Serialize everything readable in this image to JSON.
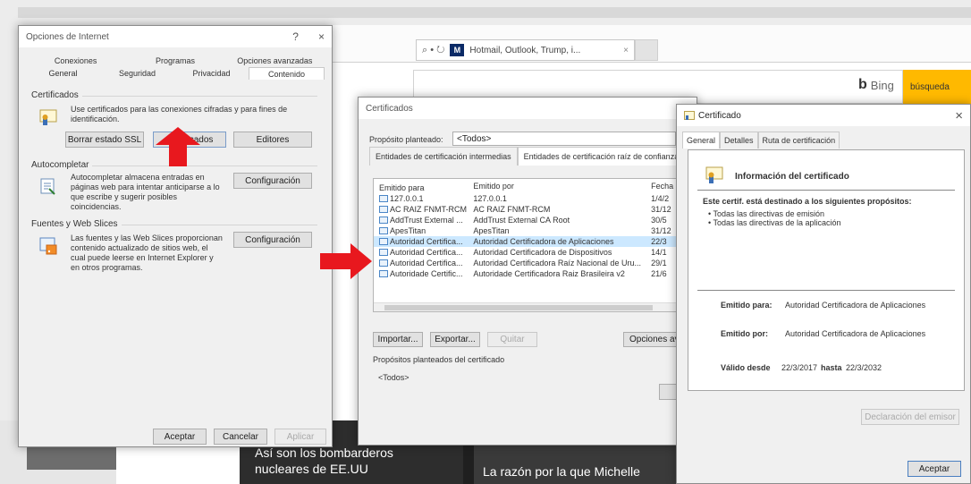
{
  "browser": {
    "tab_title": "Hotmail, Outlook, Trump, i...",
    "address_controls": "⌕ • ↻",
    "search_brand": "Bing",
    "search_button": "búsqueda",
    "news": [
      "Así son los bombarderos nucleares de EE.UU",
      "La razón por la que Michelle"
    ]
  },
  "internet_options": {
    "title": "Opciones de Internet",
    "tabs_row1": [
      "Conexiones",
      "Programas",
      "Opciones avanzadas"
    ],
    "tabs_row2": [
      "General",
      "Seguridad",
      "Privacidad",
      "Contenido"
    ],
    "active_tab": "Contenido",
    "certificates": {
      "label": "Certificados",
      "description": "Use certificados para las conexiones cifradas y para fines de identificación.",
      "buttons": [
        "Borrar estado SSL",
        "Certificados",
        "Editores"
      ]
    },
    "autocomplete": {
      "label": "Autocompletar",
      "description": "Autocompletar almacena entradas en páginas web para intentar anticiparse a lo que escribe y sugerir posibles coincidencias.",
      "button": "Configuración"
    },
    "feeds": {
      "label": "Fuentes y Web Slices",
      "description": "Las fuentes y las Web Slices proporcionan contenido actualizado de sitios web, el cual puede leerse en Internet Explorer y en otros programas.",
      "button": "Configuración"
    },
    "footer_buttons": [
      "Aceptar",
      "Cancelar",
      "Aplicar"
    ]
  },
  "certificates_dialog": {
    "title": "Certificados",
    "purpose_label": "Propósito planteado:",
    "purpose_value": "<Todos>",
    "tabs": [
      "Entidades de certificación intermedias",
      "Entidades de certificación raíz de confianza"
    ],
    "columns": [
      "Emitido para",
      "Emitido por",
      "Fecha"
    ],
    "rows": [
      [
        "127.0.0.1",
        "127.0.0.1",
        "1/4/2"
      ],
      [
        "AC RAIZ FNMT-RCM",
        "AC RAIZ FNMT-RCM",
        "31/12"
      ],
      [
        "AddTrust External ...",
        "AddTrust External CA Root",
        "30/5"
      ],
      [
        "ApesTitan",
        "ApesTitan",
        "31/12"
      ],
      [
        "Autoridad Certifica...",
        "Autoridad Certificadora de Aplicaciones",
        "22/3"
      ],
      [
        "Autoridad Certifica...",
        "Autoridad Certificadora de Dispositivos",
        "14/1"
      ],
      [
        "Autoridad Certifica...",
        "Autoridad Certificadora Raíz Nacional de Uru...",
        "29/1"
      ],
      [
        "Autoridade Certific...",
        "Autoridade Certificadora Raiz Brasileira v2",
        "21/6"
      ]
    ],
    "selected_row": 4,
    "buttons": [
      "Importar...",
      "Exportar...",
      "Quitar",
      "Opciones avanzadas"
    ],
    "purposes_label": "Propósitos planteados del certificado",
    "purposes_value": "<Todos>"
  },
  "certificate_detail": {
    "title": "Certificado",
    "tabs": [
      "General",
      "Detalles",
      "Ruta de certificación"
    ],
    "heading": "Información del certificado",
    "intro": "Este certif. está destinado a los siguientes propósitos:",
    "bullets": [
      "• Todas las directivas de emisión",
      "• Todas las directivas de la aplicación"
    ],
    "issued_to_label": "Emitido para:",
    "issued_to_value": "Autoridad Certificadora de Aplicaciones",
    "issued_by_label": "Emitido por:",
    "issued_by_value": "Autoridad Certificadora de Aplicaciones",
    "valid_from_label": "Válido desde",
    "valid_from_value": "22/3/2017",
    "valid_to_label": "hasta",
    "valid_to_value": "22/3/2032",
    "statement_button": "Declaración del emisor",
    "ok_button": "Aceptar"
  },
  "colors": {
    "arrow": "#e8181e",
    "selection": "#cce8ff",
    "bing_button": "#ffb900"
  }
}
